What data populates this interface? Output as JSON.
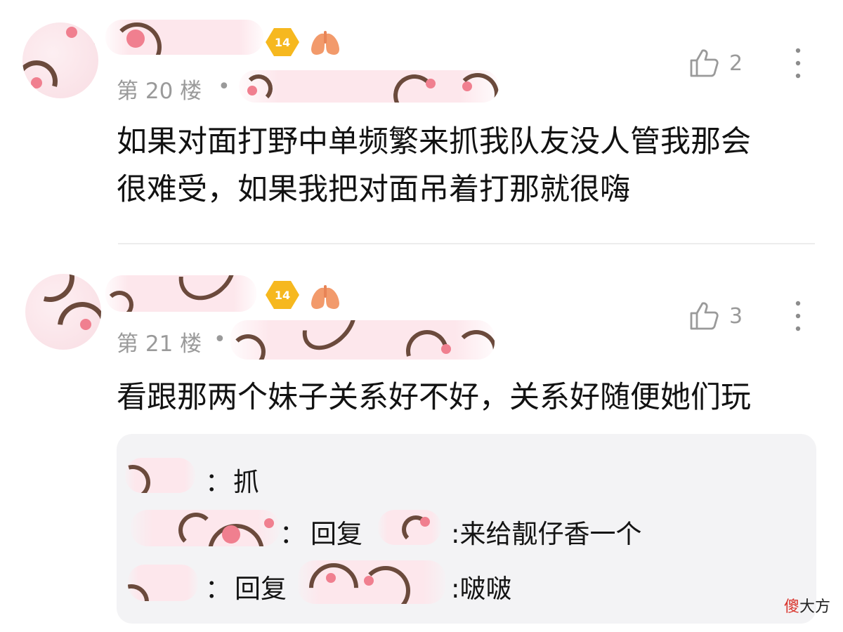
{
  "comments": [
    {
      "floor": "第 20 楼",
      "separator": "•",
      "level": "14",
      "likes": "2",
      "text_lines": [
        "如果对面打野中单频繁来抓我队友没人管我那会",
        "很难受，如果我把对面吊着打那就很嗨"
      ]
    },
    {
      "floor": "第 21 楼",
      "separator": "•",
      "level": "14",
      "likes": "3",
      "text_lines": [
        "看跟那两个妹子关系好不好，关系好随便她们玩"
      ]
    }
  ],
  "replies": [
    {
      "colon": "：",
      "text": "抓"
    },
    {
      "colon": "：",
      "reply_word": "回复",
      "text": ":来给靓仔香一个"
    },
    {
      "colon": "：",
      "reply_word": "回复",
      "text": ":啵啵"
    }
  ],
  "watermark": {
    "accent": "傻",
    "rest": "大方"
  },
  "icons": {
    "like": "thumbs-up-icon",
    "more": "more-vertical-icon",
    "badge": "lung-icon"
  },
  "colors": {
    "badge": "#f6b81f",
    "meta_gray": "#9a9a9a",
    "mask_pink": "#fde7ec",
    "reply_bg": "#f3f3f5"
  }
}
